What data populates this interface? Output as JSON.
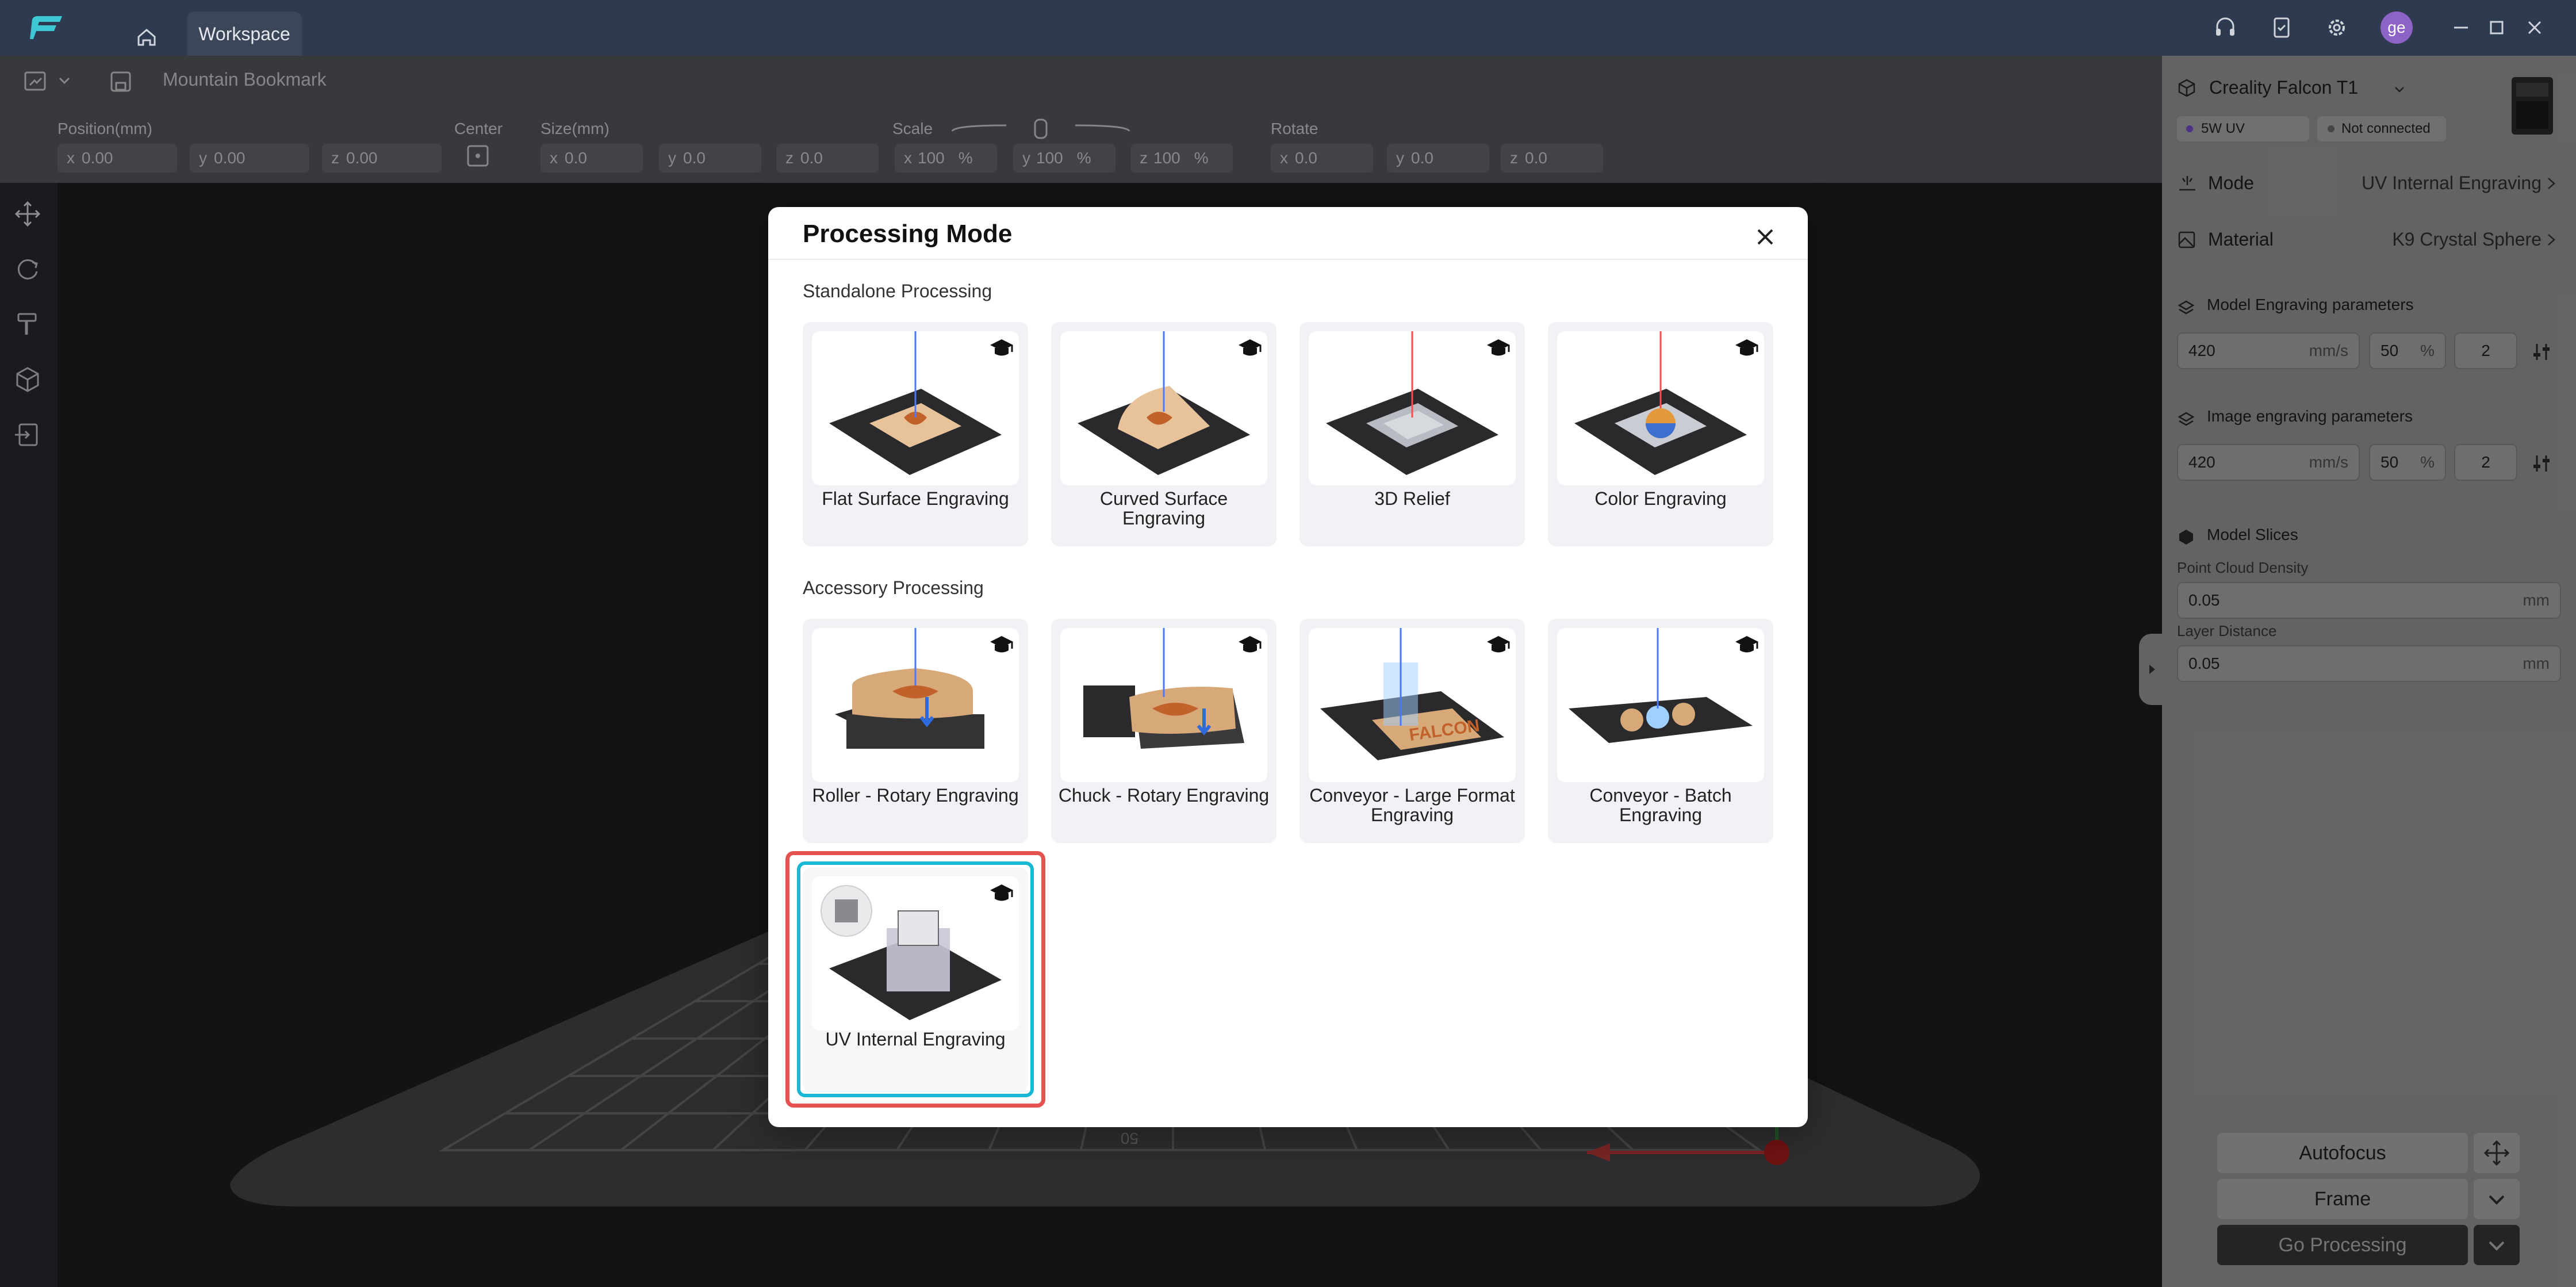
{
  "window": {
    "tab_label": "Workspace",
    "avatar_initials": "ge"
  },
  "toolbar": {
    "project_name": "Mountain Bookmark",
    "position_label": "Position(mm)",
    "center_label": "Center",
    "size_label": "Size(mm)",
    "scale_label": "Scale",
    "rotate_label": "Rotate",
    "position": [
      {
        "axis": "x",
        "value": "0.00"
      },
      {
        "axis": "y",
        "value": "0.00"
      },
      {
        "axis": "z",
        "value": "0.00"
      }
    ],
    "size": [
      {
        "axis": "x",
        "value": "0.0"
      },
      {
        "axis": "y",
        "value": "0.0"
      },
      {
        "axis": "z",
        "value": "0.0"
      }
    ],
    "scale": [
      {
        "axis": "x",
        "value": "100",
        "unit": "%"
      },
      {
        "axis": "y",
        "value": "100",
        "unit": "%"
      },
      {
        "axis": "z",
        "value": "100",
        "unit": "%"
      }
    ],
    "rotate": [
      {
        "axis": "x",
        "value": "0.0"
      },
      {
        "axis": "y",
        "value": "0.0"
      },
      {
        "axis": "z",
        "value": "0.0"
      }
    ]
  },
  "right_panel": {
    "device_name": "Creality Falcon T1",
    "laser_type": "5W UV",
    "connection_status": "Not connected",
    "mode_label": "Mode",
    "mode_value": "UV Internal Engraving",
    "material_label": "Material",
    "material_value": "K9 Crystal Sphere",
    "model_params_title": "Model Engraving parameters",
    "model_speed": "420",
    "model_speed_unit": "mm/s",
    "model_power": "50",
    "model_power_unit": "%",
    "model_passes": "2",
    "image_params_title": "Image engraving parameters",
    "image_speed": "420",
    "image_speed_unit": "mm/s",
    "image_power": "50",
    "image_power_unit": "%",
    "image_passes": "2",
    "slices_title": "Model Slices",
    "density_label": "Point Cloud Density",
    "density_value": "0.05",
    "density_unit": "mm",
    "layer_label": "Layer Distance",
    "layer_value": "0.05",
    "layer_unit": "mm",
    "autofocus_label": "Autofocus",
    "frame_label": "Frame",
    "go_label": "Go Processing"
  },
  "modal": {
    "title": "Processing Mode",
    "standalone_title": "Standalone Processing",
    "accessory_title": "Accessory Processing",
    "standalone": [
      {
        "label": "Flat Surface Engraving"
      },
      {
        "label": "Curved Surface Engraving"
      },
      {
        "label": "3D Relief"
      },
      {
        "label": "Color Engraving"
      }
    ],
    "accessory": [
      {
        "label": "Roller - Rotary Engraving"
      },
      {
        "label": "Chuck - Rotary Engraving"
      },
      {
        "label": "Conveyor - Large Format Engraving"
      },
      {
        "label": "Conveyor - Batch Engraving"
      }
    ],
    "uv": {
      "label": "UV Internal Engraving",
      "selected": true
    },
    "conveyor_logo_text": "FALCON"
  },
  "viewport": {
    "ruler_label": "50"
  },
  "colors": {
    "highlight_red": "#e4534f",
    "selected_cyan": "#19b7d6",
    "accent_teal": "#3fc7d4",
    "laser_blue": "#4a78ff",
    "laser_red": "#ff4a4a"
  }
}
